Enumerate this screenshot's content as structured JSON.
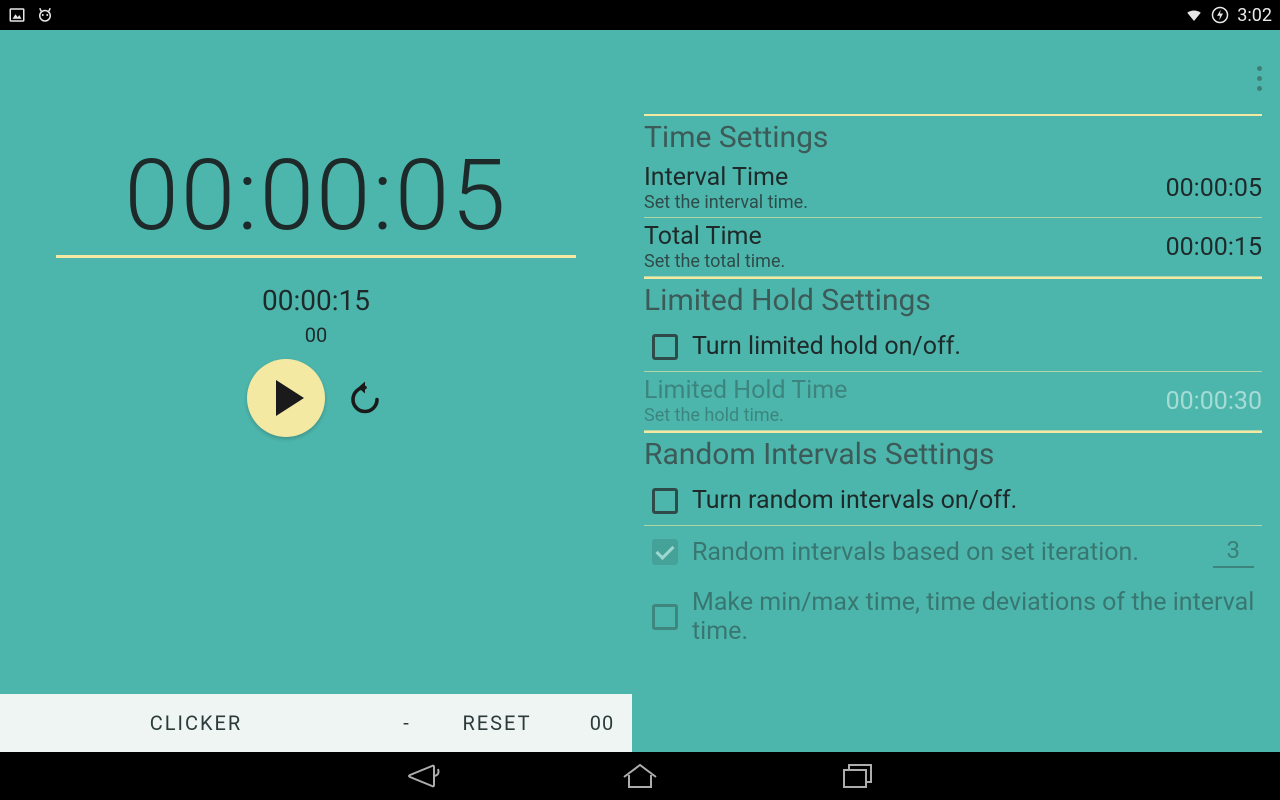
{
  "statusbar": {
    "time": "3:02"
  },
  "timer": {
    "main": "00:00:05",
    "sub": "00:00:15",
    "counter": "00"
  },
  "bottombar": {
    "clicker": "CLICKER",
    "dash": "-",
    "reset": "RESET",
    "count": "00"
  },
  "settings": {
    "time": {
      "header": "Time Settings",
      "interval": {
        "title": "Interval Time",
        "sub": "Set the interval time.",
        "value": "00:00:05"
      },
      "total": {
        "title": "Total Time",
        "sub": "Set the total time.",
        "value": "00:00:15"
      }
    },
    "limited": {
      "header": "Limited Hold Settings",
      "toggle": "Turn limited hold on/off.",
      "holdtime": {
        "title": "Limited Hold Time",
        "sub": "Set the hold time.",
        "value": "00:00:30"
      }
    },
    "random": {
      "header": "Random Intervals Settings",
      "toggle": "Turn random intervals on/off.",
      "iteration": {
        "label": "Random intervals based on set iteration.",
        "value": "3"
      },
      "minmax": {
        "label": "Make min/max time, time deviations of the interval time."
      }
    }
  }
}
